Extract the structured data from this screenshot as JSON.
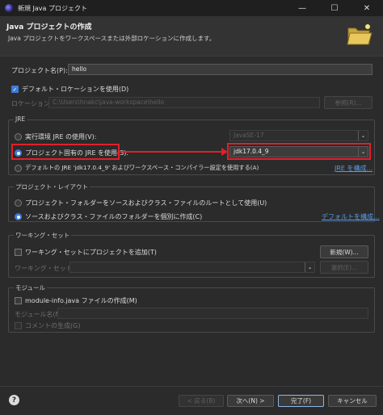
{
  "window": {
    "title": "新規 Java プロジェクト",
    "minimize": "—",
    "maximize": "☐",
    "close": "✕"
  },
  "header": {
    "title": "Java プロジェクトの作成",
    "description": "Java プロジェクトをワークスペースまたは外部ロケーションに作成します。"
  },
  "project": {
    "name_label": "プロジェクト名(P):",
    "name_value": "hello",
    "use_default_location_label": "デフォルト・ロケーションを使用(D)",
    "use_default_location_checked": true,
    "location_label": "ロケーション(L):",
    "location_value": "C:\\Users\\hnakc\\java-workspace\\hello",
    "browse_label": "参照(R)..."
  },
  "jre": {
    "group_title": "JRE",
    "exec_env_label": "実行環境 JRE の使用(V):",
    "exec_env_value": "JavaSE-17",
    "project_jre_label": "プロジェクト固有の JRE を使用(S):",
    "project_jre_value": "jdk17.0.4_9",
    "default_jre_label": "デフォルトの JRE 'jdk17.0.4_9' およびワークスペース・コンパイラー設定を使用する(A)",
    "configure_link": "JRE を構成..."
  },
  "layout": {
    "group_title": "プロジェクト・レイアウト",
    "option1_label": "プロジェクト・フォルダーをソースおよびクラス・ファイルのルートとして使用(U)",
    "option2_label": "ソースおよびクラス・ファイルのフォルダーを個別に作成(C)",
    "configure_default_link": "デフォルトを構成..."
  },
  "working_set": {
    "group_title": "ワーキング・セット",
    "add_label": "ワーキング・セットにプロジェクトを追加(T)",
    "new_button": "新規(W)...",
    "sets_label": "ワーキング・セット(O):",
    "select_button": "選択(E)..."
  },
  "module": {
    "group_title": "モジュール",
    "create_label": "module-info.java ファイルの作成(M)",
    "name_label": "モジュール名(N):",
    "comment_label": "コメントの生成(G)"
  },
  "footer": {
    "help": "?",
    "back": "< 戻る(B)",
    "next": "次へ(N) >",
    "finish": "完了(F)",
    "cancel": "キャンセル"
  },
  "colors": {
    "accent": "#3d7bd8",
    "highlight_box": "#e0202a",
    "link": "#5a9be8"
  }
}
